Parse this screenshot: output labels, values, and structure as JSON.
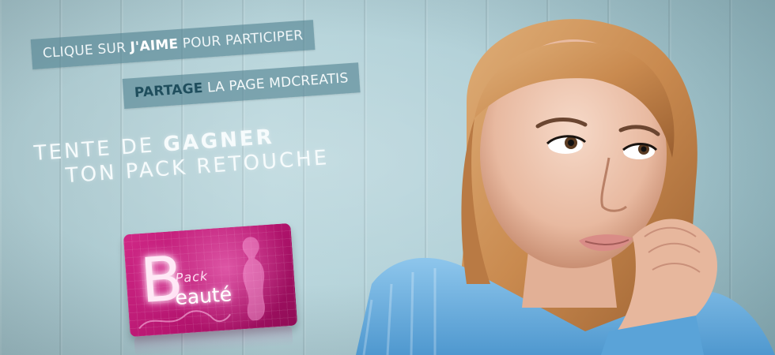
{
  "ribbon_1": {
    "prefix": "CLIQUE SUR ",
    "bold": "J'AIME",
    "suffix": " POUR PARTICIPER"
  },
  "ribbon_2": {
    "bold": "PARTAGE",
    "suffix": " LA PAGE MDCREATIS"
  },
  "headline": {
    "line1_prefix": "TENTE DE ",
    "line1_bold": "GAGNER",
    "line2": "TON PACK RETOUCHE"
  },
  "card": {
    "initial": "B",
    "pack": "Pack",
    "beaute": "eauté"
  },
  "colors": {
    "background": "#b4d2d9",
    "ribbon": "#528291",
    "card": "#c21c7a",
    "sweater": "#6fb2e0"
  }
}
